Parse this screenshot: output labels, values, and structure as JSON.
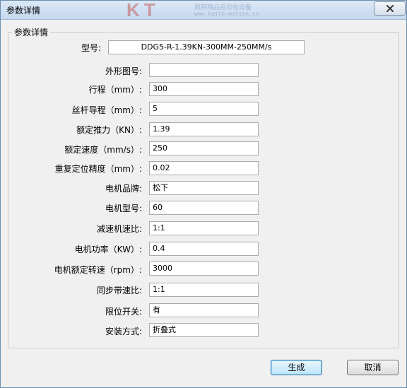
{
  "window": {
    "title": "参数详情",
    "watermark": {
      "logo": "KT",
      "text_line1": "凯特精品自动化设备",
      "text_line2": "www.kaite-motion.cn"
    }
  },
  "group": {
    "legend": "参数详情"
  },
  "fields": [
    {
      "label": "型号:",
      "value": "DDG5-R-1.39KN-300MM-250MM/s"
    },
    {
      "label": "外形图号:",
      "value": ""
    },
    {
      "label": "行程（mm）:",
      "value": "300"
    },
    {
      "label": "丝杆导程（mm）:",
      "value": "5"
    },
    {
      "label": "额定推力（KN）:",
      "value": "1.39"
    },
    {
      "label": "额定速度（mm/s）:",
      "value": "250"
    },
    {
      "label": "重复定位精度（mm）:",
      "value": "0.02"
    },
    {
      "label": "电机品牌:",
      "value": "松下"
    },
    {
      "label": "电机型号:",
      "value": "60"
    },
    {
      "label": "减速机速比:",
      "value": "1:1"
    },
    {
      "label": "电机功率（KW）:",
      "value": "0.4"
    },
    {
      "label": "电机额定转速（rpm）:",
      "value": "3000"
    },
    {
      "label": "同步带速比:",
      "value": "1:1"
    },
    {
      "label": "限位开关:",
      "value": "有"
    },
    {
      "label": "安装方式:",
      "value": "折叠式"
    }
  ],
  "buttons": {
    "generate": "生成",
    "cancel": "取消"
  }
}
